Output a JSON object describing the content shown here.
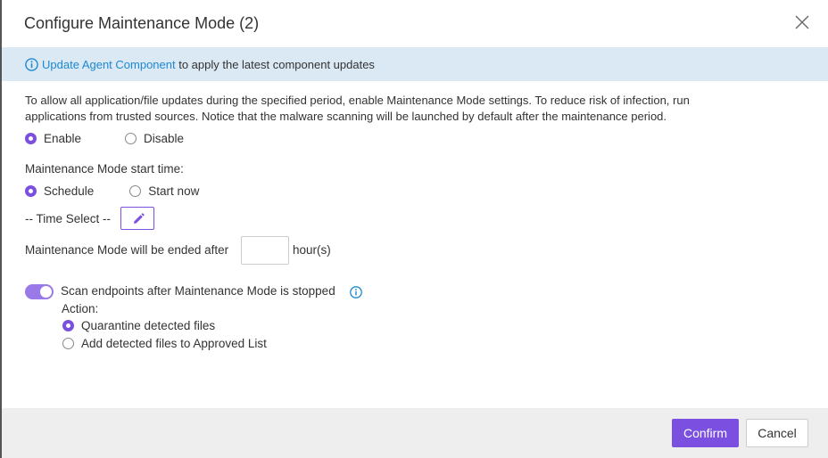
{
  "dialog": {
    "title": "Configure Maintenance Mode (2)",
    "close_icon": "close-icon"
  },
  "banner": {
    "icon": "info-icon",
    "link_text": "Update Agent Component",
    "text": " to apply the latest component updates"
  },
  "description": {
    "line1": "To allow all application/file updates during the specified period, enable Maintenance Mode settings. To reduce risk of infection, run",
    "line2": "applications from trusted sources. Notice that the malware scanning will be launched by default after the maintenance period."
  },
  "mode": {
    "enable_label": "Enable",
    "disable_label": "Disable",
    "selected": "Enable"
  },
  "start_time": {
    "label": "Maintenance Mode start time:",
    "schedule_label": "Schedule",
    "start_now_label": "Start now",
    "selected": "Schedule",
    "time_select_label": "-- Time Select --",
    "edit_icon": "pencil-icon"
  },
  "end_after": {
    "label": "Maintenance Mode will be ended after",
    "value": "",
    "unit": "hour(s)"
  },
  "scan": {
    "toggle_on": true,
    "label": "Scan endpoints after Maintenance Mode is stopped",
    "info_icon": "info-icon",
    "action_label": "Action:",
    "quarantine_label": "Quarantine detected files",
    "approved_label": "Add detected files to Approved List",
    "selected": "Quarantine detected files"
  },
  "footer": {
    "confirm_label": "Confirm",
    "cancel_label": "Cancel"
  },
  "colors": {
    "accent": "#7b4fe0",
    "banner_bg": "#dbe9f5",
    "link": "#1e88d1",
    "footer_bg": "#eeeeee"
  }
}
